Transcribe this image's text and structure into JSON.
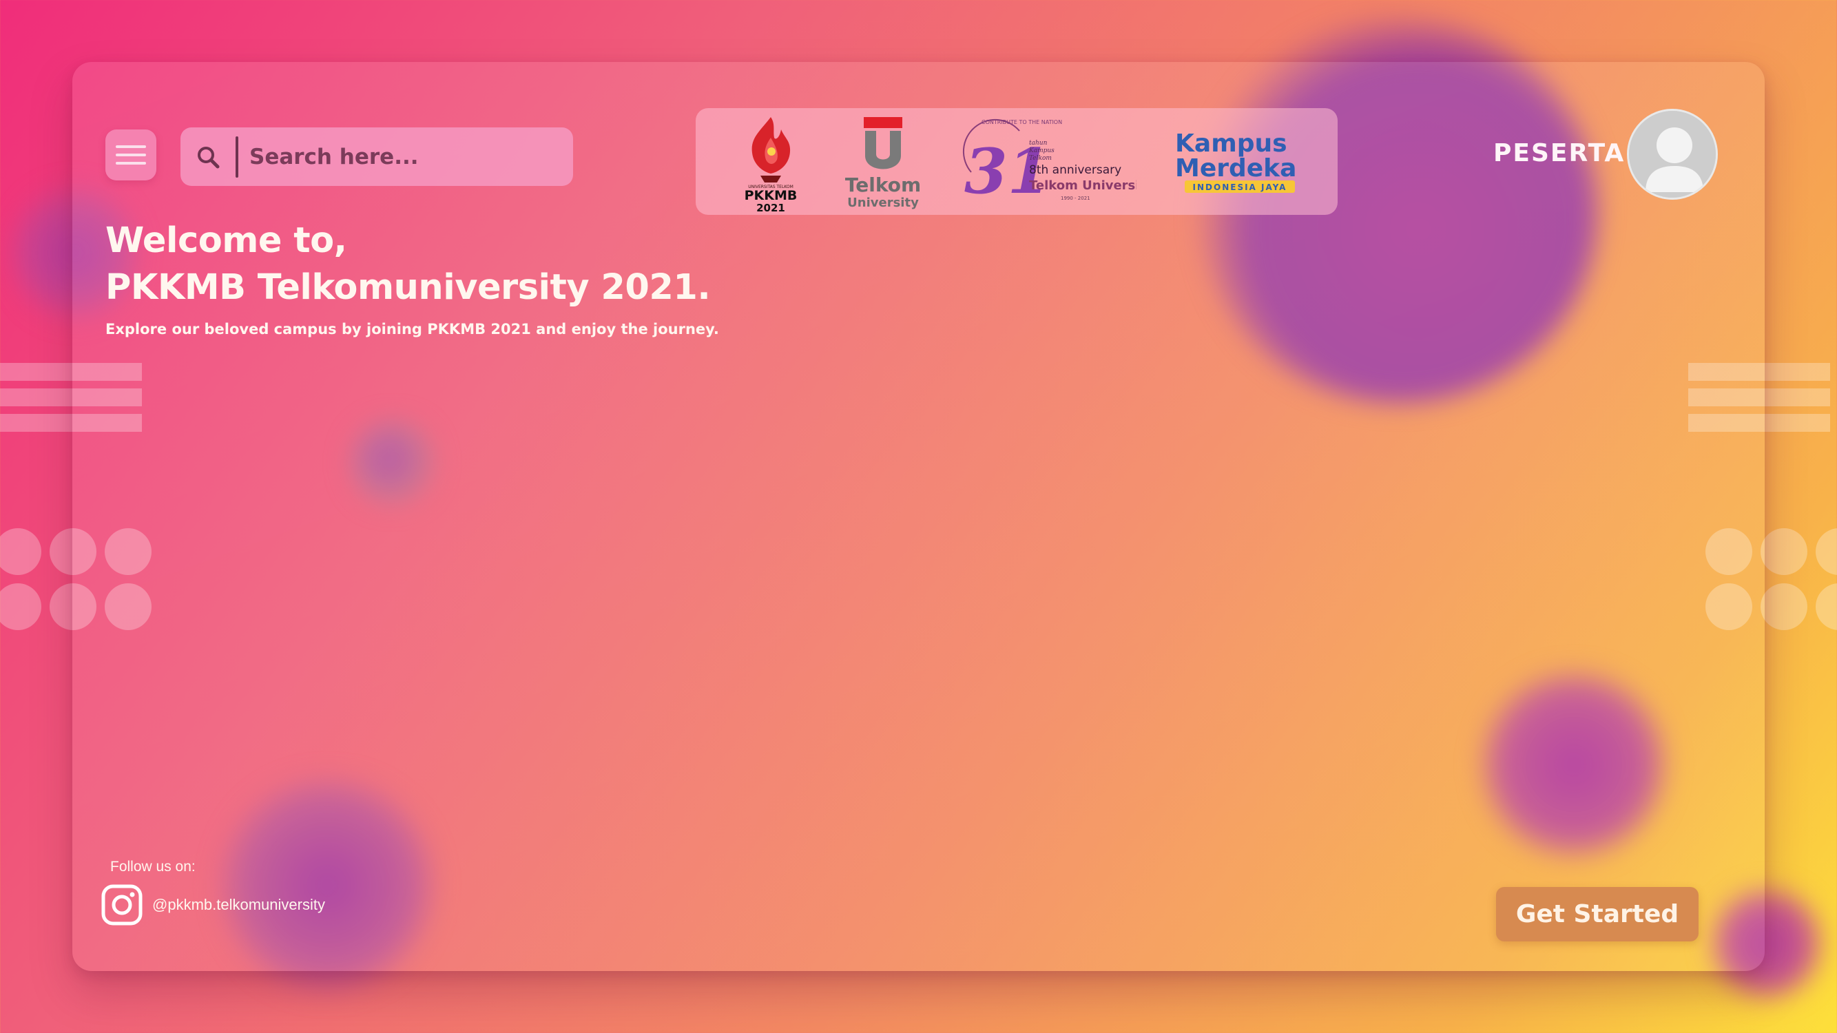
{
  "header": {
    "menu_icon": "hamburger-menu-icon",
    "search": {
      "placeholder": "Search here...",
      "value": "",
      "icon": "search-icon"
    },
    "logos": {
      "pkkmb_line1": "UNIVERSITAS TELKOM",
      "pkkmb_name": "PKKMB",
      "pkkmb_year": "2021",
      "telkom_name": "Telkom",
      "telkom_sub": "University",
      "anniv_ring": "CONTRIBUTE TO THE NATION",
      "anniv_number": "31",
      "anniv_tahun": "tahun",
      "anniv_kampus": "Kampus",
      "anniv_telkom": "Telkom",
      "anniv_eighth": "8th anniversary",
      "anniv_tu": "Telkom University",
      "anniv_years": "1990 - 2021",
      "merdeka_line1": "Kampus",
      "merdeka_line2": "Merdeka",
      "merdeka_ribbon": "INDONESIA JAYA"
    },
    "user_role": "PESERTA",
    "avatar_icon": "user-avatar-icon"
  },
  "hero": {
    "title_line1": "Welcome to,",
    "title_line2": "PKKMB Telkomuniversity 2021.",
    "subtitle": "Explore our beloved campus by joining PKKMB 2021 and enjoy the journey."
  },
  "footer": {
    "follow_label": "Follow us on:",
    "instagram_handle": "@pkkmb.telkomuniversity",
    "instagram_icon": "instagram-icon",
    "cta_label": "Get Started"
  },
  "colors": {
    "gradient_start": "#f02d7a",
    "gradient_end": "#fde03a",
    "cta": "#d78a50",
    "search_text": "#6e3350"
  }
}
